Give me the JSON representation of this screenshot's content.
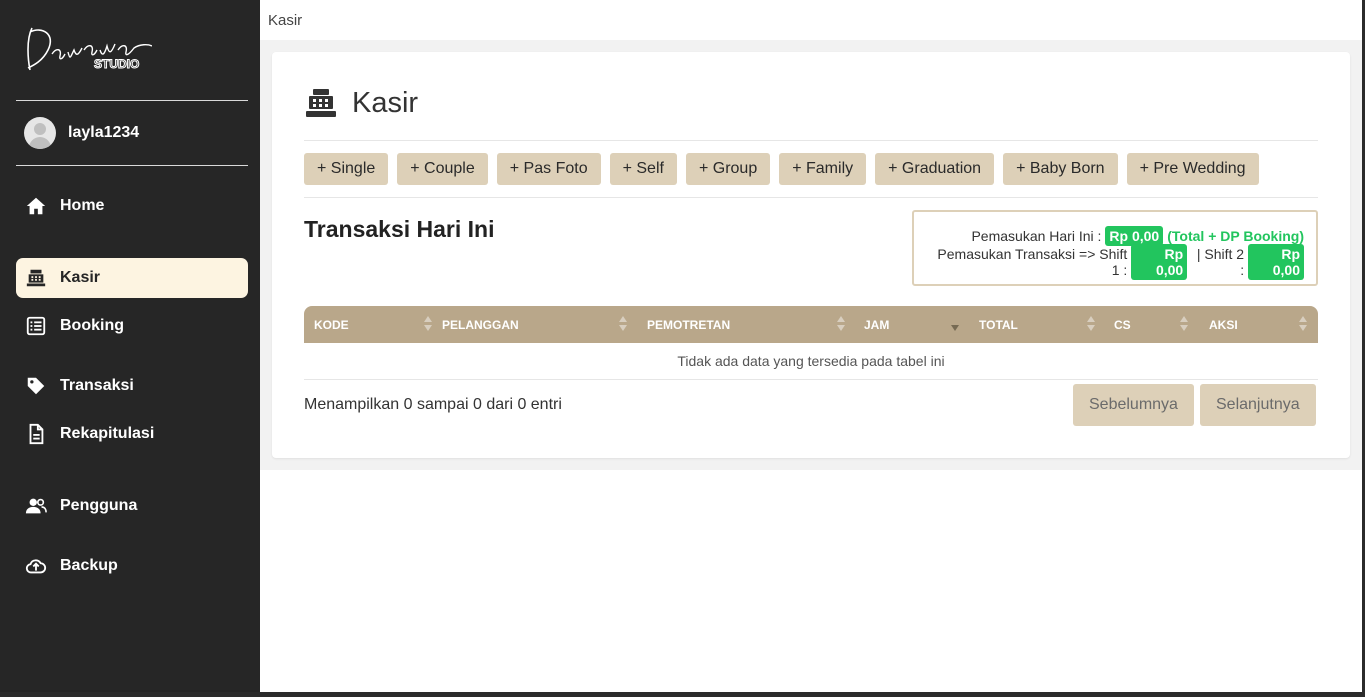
{
  "brand": {
    "logo_script": "Danawa",
    "logo_sub": "STUDIO"
  },
  "user": {
    "username": "layla1234"
  },
  "nav": [
    {
      "label": "Home",
      "icon": "home-icon",
      "active": false
    },
    {
      "label": "Kasir",
      "icon": "cash-register-icon",
      "active": true
    },
    {
      "label": "Booking",
      "icon": "list-icon",
      "active": false
    },
    {
      "label": "Transaksi",
      "icon": "tag-icon",
      "active": false
    },
    {
      "label": "Rekapitulasi",
      "icon": "document-icon",
      "active": false
    },
    {
      "label": "Pengguna",
      "icon": "users-icon",
      "active": false
    },
    {
      "label": "Backup",
      "icon": "cloud-upload-icon",
      "active": false
    }
  ],
  "topbar": {
    "breadcrumb": "Kasir"
  },
  "page": {
    "title": "Kasir",
    "section_title": "Transaksi Hari Ini"
  },
  "packages": [
    "+ Single",
    "+ Couple",
    "+ Pas Foto",
    "+ Self",
    "+ Group",
    "+ Family",
    "+ Graduation",
    "+ Baby Born",
    "+ Pre Wedding"
  ],
  "income": {
    "today_label": "Pemasukan Hari Ini :",
    "today_value": "Rp 0,00",
    "today_note": "(Total + DP Booking)",
    "trans_label": "Pemasukan Transaksi => Shift 1 :",
    "shift1_value": "Rp 0,00",
    "shift2_label": "| Shift 2 :",
    "shift2_value": "Rp 0,00"
  },
  "table": {
    "columns": [
      "KODE",
      "PELANGGAN",
      "PEMOTRETAN",
      "JAM",
      "TOTAL",
      "CS",
      "AKSI"
    ],
    "empty_text": "Tidak ada data yang tersedia pada tabel ini"
  },
  "pagination": {
    "info": "Menampilkan 0 sampai 0 dari 0 entri",
    "prev_label": "Sebelumnya",
    "next_label": "Selanjutnya"
  },
  "colors": {
    "sidebar_bg": "#262626",
    "accent": "#ddd0b8",
    "table_header": "#b9a78a",
    "active_nav": "#fdf4e1",
    "badge_green": "#22c55e"
  }
}
